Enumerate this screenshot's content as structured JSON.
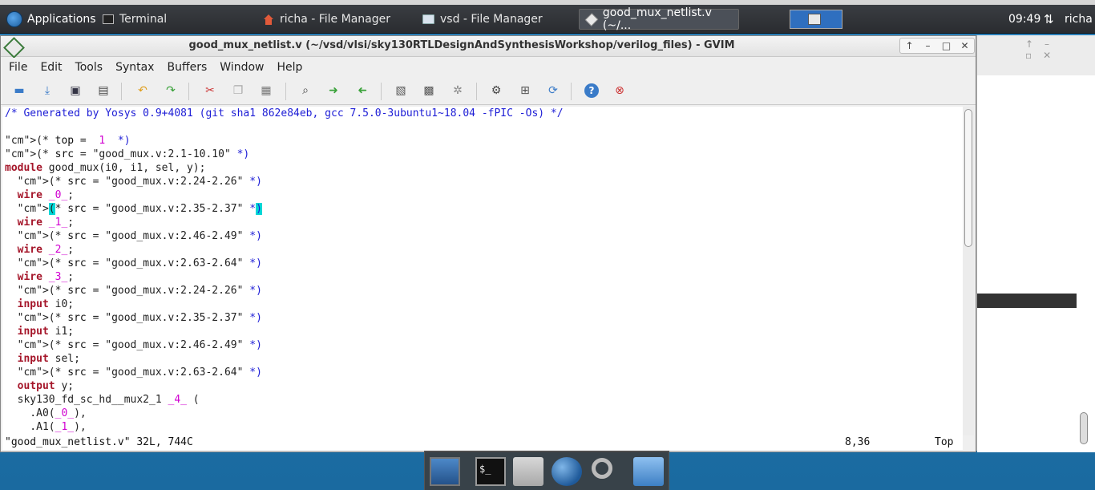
{
  "taskbar": {
    "apps_label": "Applications",
    "tasks": [
      {
        "label": "Terminal"
      },
      {
        "label": "richa - File Manager"
      },
      {
        "label": "vsd - File Manager"
      },
      {
        "label": "good_mux_netlist.v (~/..."
      }
    ],
    "clock": "09:49",
    "user": "richa"
  },
  "window": {
    "title": "good_mux_netlist.v (~/vsd/vlsi/sky130RTLDesignAndSynthesisWorkshop/verilog_files) - GVIM"
  },
  "menu": [
    "File",
    "Edit",
    "Tools",
    "Syntax",
    "Buffers",
    "Window",
    "Help"
  ],
  "toolbar_icons": [
    "open-icon",
    "save-icon",
    "save-all-icon",
    "print-icon",
    "undo-icon",
    "redo-icon",
    "cut-icon",
    "copy-icon",
    "paste-icon",
    "find-icon",
    "find-next-icon",
    "find-prev-icon",
    "load-session-icon",
    "save-session-icon",
    "run-script-icon",
    "make-icon",
    "shell-icon",
    "tags-icon",
    "help-icon",
    "find-help-icon"
  ],
  "editor": {
    "lines": [
      "/* Generated by Yosys 0.9+4081 (git sha1 862e84eb, gcc 7.5.0-3ubuntu1~18.04 -fPIC -Os) */",
      "",
      "(* top =  1  *)",
      "(* src = \"good_mux.v:2.1-10.10\" *)",
      "module good_mux(i0, i1, sel, y);",
      "  (* src = \"good_mux.v:2.24-2.26\" *)",
      "  wire _0_;",
      "  (* src = \"good_mux.v:2.35-2.37\" *)",
      "  wire _1_;",
      "  (* src = \"good_mux.v:2.46-2.49\" *)",
      "  wire _2_;",
      "  (* src = \"good_mux.v:2.63-2.64\" *)",
      "  wire _3_;",
      "  (* src = \"good_mux.v:2.24-2.26\" *)",
      "  input i0;",
      "  (* src = \"good_mux.v:2.35-2.37\" *)",
      "  input i1;",
      "  (* src = \"good_mux.v:2.46-2.49\" *)",
      "  input sel;",
      "  (* src = \"good_mux.v:2.63-2.64\" *)",
      "  output y;",
      "  sky130_fd_sc_hd__mux2_1 _4_ (",
      "    .A0(_0_),",
      "    .A1(_1_),"
    ],
    "cursor_line": 8,
    "cursor_col": 36
  },
  "status": {
    "file_info": "\"good_mux_netlist.v\" 32L, 744C",
    "position": "8,36",
    "scroll": "Top"
  },
  "dock": {
    "term_glyph": "$_"
  }
}
